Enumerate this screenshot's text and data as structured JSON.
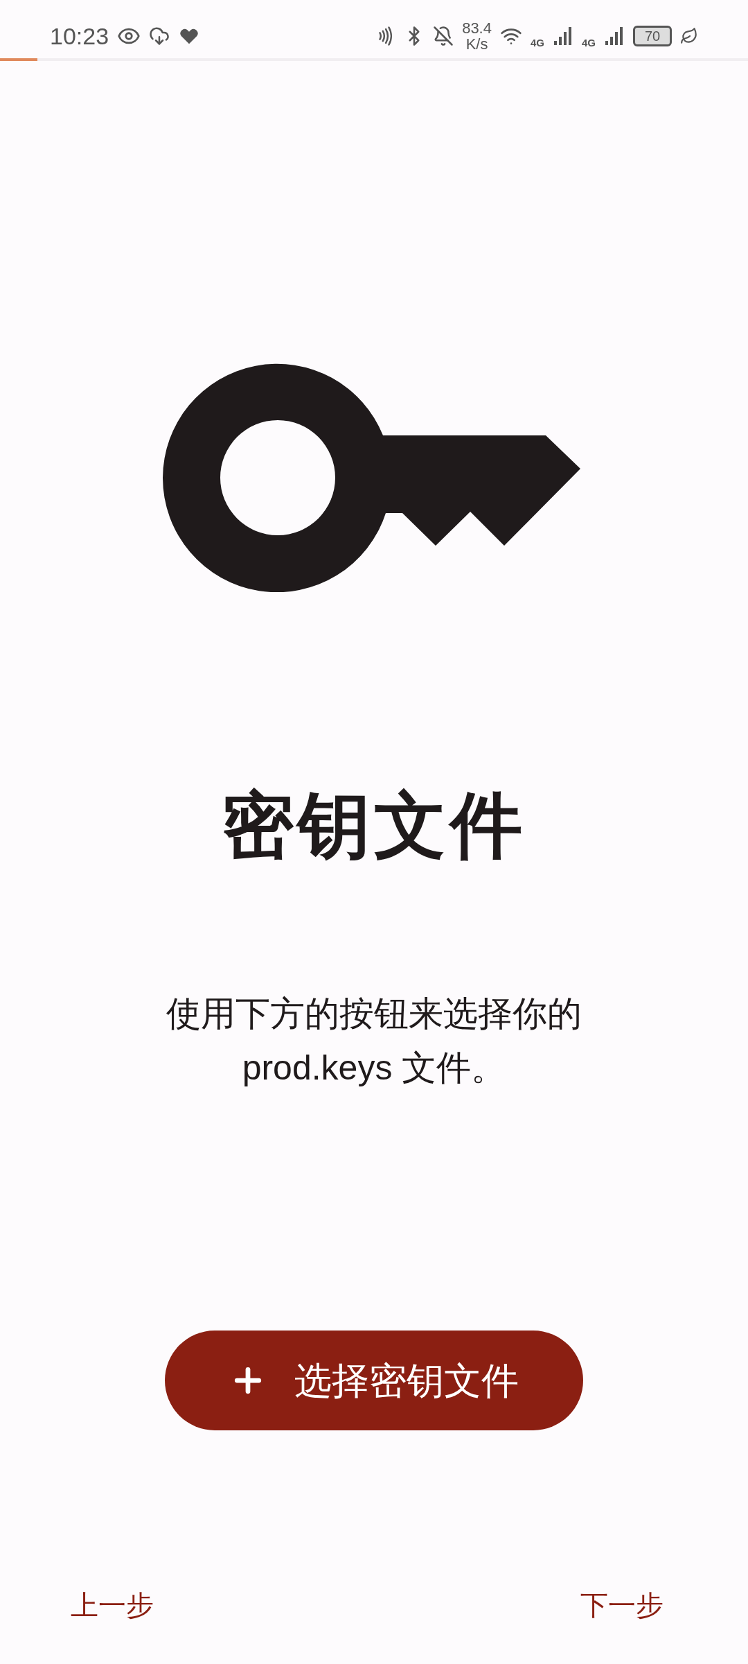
{
  "status_bar": {
    "time": "10:23",
    "net_speed": "83.4",
    "net_unit": "K/s",
    "sim_1": "4G",
    "sim_2": "4G",
    "battery": "70"
  },
  "progress": {
    "level": 0.05
  },
  "title": "密钥文件",
  "description": "使用下方的按钮来选择你的 prod.keys 文件。",
  "select_button": {
    "label": "选择密钥文件"
  },
  "nav": {
    "back": "上一步",
    "next": "下一步"
  }
}
